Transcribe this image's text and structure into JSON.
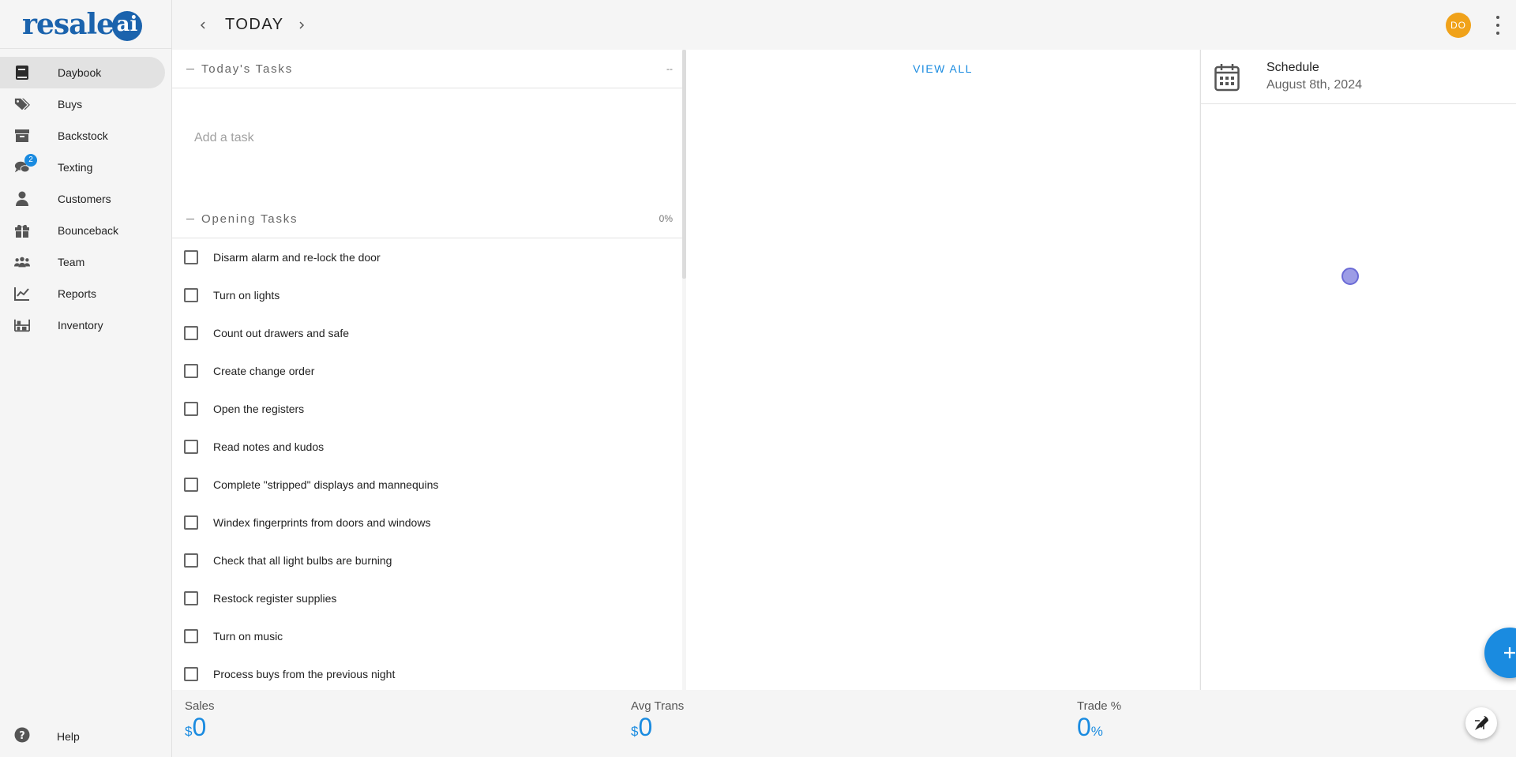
{
  "app": {
    "logo_text": "resale",
    "logo_mark": "ai"
  },
  "sidebar": {
    "items": [
      {
        "label": "Daybook",
        "icon": "book-icon",
        "active": true
      },
      {
        "label": "Buys",
        "icon": "tags-icon"
      },
      {
        "label": "Backstock",
        "icon": "archive-icon"
      },
      {
        "label": "Texting",
        "icon": "chat-icon",
        "badge": "2"
      },
      {
        "label": "Customers",
        "icon": "user-icon"
      },
      {
        "label": "Bounceback",
        "icon": "gift-icon"
      },
      {
        "label": "Team",
        "icon": "team-icon"
      },
      {
        "label": "Reports",
        "icon": "chart-icon"
      },
      {
        "label": "Inventory",
        "icon": "inventory-icon"
      }
    ],
    "help_label": "Help"
  },
  "header": {
    "title": "TODAY",
    "avatar_initials": "DO"
  },
  "todays_tasks": {
    "title": "Today's Tasks",
    "right": "--",
    "add_placeholder": "Add a task"
  },
  "opening_tasks": {
    "title": "Opening Tasks",
    "progress": "0%",
    "items": [
      "Disarm alarm and re-lock the door",
      "Turn on lights",
      "Count out drawers and safe",
      "Create change order",
      "Open the registers",
      "Read notes and kudos",
      "Complete \"stripped\" displays and mannequins",
      "Windex fingerprints from doors and windows",
      "Check that all light bulbs are burning",
      "Restock register supplies",
      "Turn on music",
      "Process buys from the previous night"
    ]
  },
  "middle": {
    "view_all": "VIEW ALL"
  },
  "schedule": {
    "title": "Schedule",
    "date": "August 8th, 2024"
  },
  "stats": {
    "sales": {
      "label": "Sales",
      "prefix": "$",
      "value": "0"
    },
    "avg_trans": {
      "label": "Avg Trans",
      "prefix": "$",
      "value": "0"
    },
    "trade": {
      "label": "Trade %",
      "value": "0",
      "suffix": "%"
    }
  },
  "colors": {
    "accent": "#1a8be0",
    "brand": "#1b63ad",
    "avatar": "#f0a21a"
  }
}
